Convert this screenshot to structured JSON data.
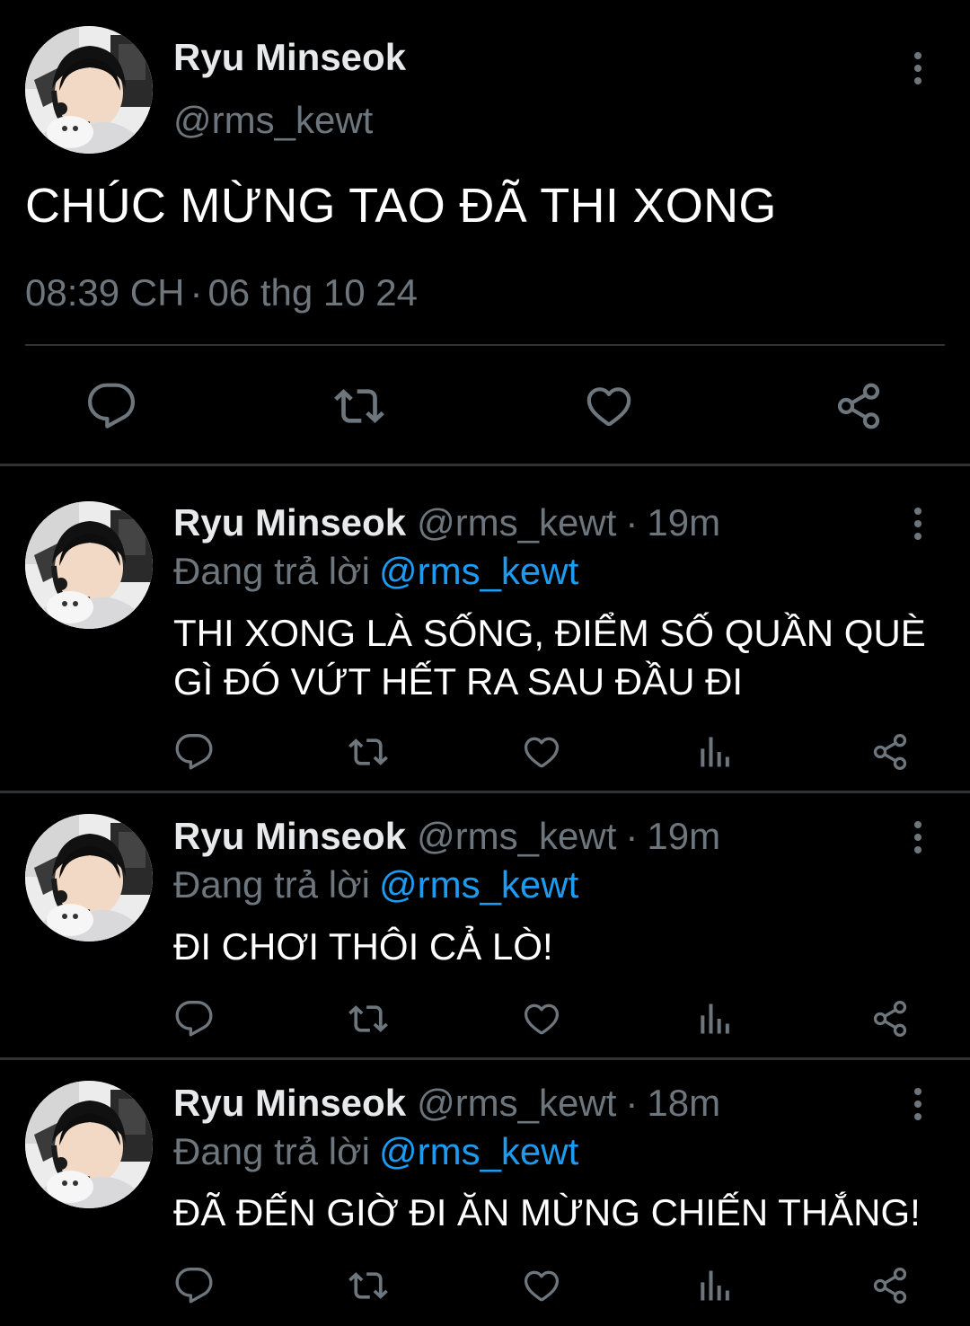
{
  "main_tweet": {
    "author_name": "Ryu Minseok",
    "handle": "@rms_kewt",
    "text": "CHÚC MỪNG TAO ĐÃ THI XONG",
    "time": "08:39 CH",
    "separator": "·",
    "date": "06 thg 10 24",
    "icons": [
      "reply-icon",
      "retweet-icon",
      "like-icon",
      "share-icon"
    ]
  },
  "replies": [
    {
      "author_name": "Ryu Minseok",
      "handle": "@rms_kewt",
      "separator": "·",
      "time": "19m",
      "replying_label": "Đang trả lời",
      "replying_handle": "@rms_kewt",
      "text": "THI XONG LÀ SỐNG, ĐIỂM SỐ QUẦN QUÈ GÌ ĐÓ VỨT HẾT RA SAU ĐẦU ĐI"
    },
    {
      "author_name": "Ryu Minseok",
      "handle": "@rms_kewt",
      "separator": "·",
      "time": "19m",
      "replying_label": "Đang trả lời",
      "replying_handle": "@rms_kewt",
      "text": "ĐI CHƠI THÔI CẢ LÒ!"
    },
    {
      "author_name": "Ryu Minseok",
      "handle": "@rms_kewt",
      "separator": "·",
      "time": "18m",
      "replying_label": "Đang trả lời",
      "replying_handle": "@rms_kewt",
      "text": "ĐÃ ĐẾN GIỜ ĐI ĂN MỪNG CHIẾN THẮNG!"
    }
  ],
  "reply_action_icons": [
    "reply-icon",
    "retweet-icon",
    "like-icon",
    "analytics-icon",
    "share-icon"
  ],
  "colors": {
    "background": "#000000",
    "text": "#e7e9ea",
    "secondary_text": "#6e767d",
    "link": "#1d9bf0",
    "divider": "#2f3336"
  }
}
